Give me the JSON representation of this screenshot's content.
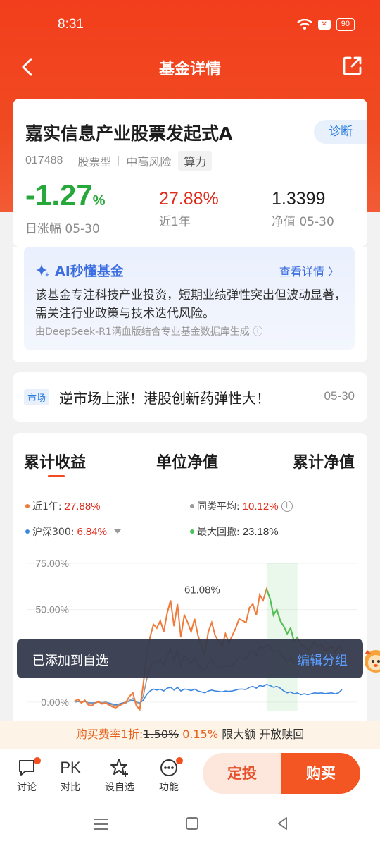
{
  "status": {
    "time": "8:31",
    "battery": "90"
  },
  "nav": {
    "title": "基金详情"
  },
  "fund": {
    "name": "嘉实信息产业股票发起式A",
    "diagnose_label": "诊断",
    "code": "017488",
    "type": "股票型",
    "risk": "中高风险",
    "tag": "算力",
    "daily_change": "-1.27",
    "daily_change_unit": "%",
    "daily_change_label": "日涨幅 05-30",
    "year_return": "27.88%",
    "year_return_label": "近1年",
    "nav_value": "1.3399",
    "nav_label": "净值 05-30"
  },
  "ai": {
    "title": "AI秒懂基金",
    "link": "查看详情 〉",
    "text": "该基金专注科技产业投资，短期业绩弹性突出但波动显著，需关注行业政策与技术迭代风险。",
    "source": "由DeepSeek-R1满血版结合专业基金数据库生成 ⓘ"
  },
  "news": {
    "tag": "市场",
    "title": "逆市场上涨！港股创新药弹性大！",
    "date": "05-30"
  },
  "chart_tabs": [
    "累计收益",
    "单位净值",
    "累计净值"
  ],
  "legend": [
    {
      "label": "近1年:",
      "value": "27.88%",
      "color": "#f07a3a",
      "value_color": "#e02b1b"
    },
    {
      "label": "同类平均:",
      "value": "10.12%",
      "color": "#999999",
      "value_color": "#e02b1b"
    },
    {
      "label": "沪深300:",
      "value": "6.84%",
      "color": "#3d86e0",
      "value_color": "#e02b1b"
    },
    {
      "label": "最大回撤:",
      "value": "23.18%",
      "color": "#4cc25a",
      "value_color": "#333333"
    }
  ],
  "chart_data": {
    "type": "line",
    "y_ticks": [
      "75.00%",
      "50.00%",
      "0.00%"
    ],
    "ylim": [
      -5,
      75
    ],
    "peak_label": "61.08%",
    "series": [
      {
        "name": "近1年",
        "color": "#f07a3a",
        "values": [
          0.5,
          1.5,
          -0.5,
          1,
          -1.5,
          -2,
          -0.5,
          0.2,
          -1,
          -0.5,
          -1.5,
          -2.5,
          -3,
          -2,
          -1,
          0,
          3,
          5,
          -2,
          -4,
          9,
          25,
          35,
          42,
          40,
          44,
          38,
          48,
          55,
          41,
          53,
          35,
          47,
          43,
          38,
          45,
          36,
          30,
          26,
          38,
          43,
          36,
          33,
          30,
          37,
          32,
          36,
          40,
          45,
          44,
          43,
          51,
          53,
          47,
          58,
          55,
          61.08,
          56,
          47,
          50,
          44,
          41,
          37,
          40,
          33,
          35,
          31,
          30,
          28,
          30,
          33,
          30,
          31,
          28,
          29,
          30,
          27,
          30,
          28
        ]
      },
      {
        "name": "同类平均",
        "color": "#9a9a9a",
        "values": [
          0,
          0.5,
          0,
          0.5,
          -0.5,
          -1,
          -0.5,
          0,
          -0.5,
          0,
          -1,
          -1.5,
          -2,
          -1.5,
          -1,
          -0.5,
          1,
          2,
          0,
          -1,
          3,
          12,
          18,
          22,
          21,
          23,
          20,
          25,
          29,
          22,
          28,
          20,
          25,
          23,
          21,
          24,
          20,
          18,
          17,
          21,
          23,
          20,
          19,
          18,
          20,
          19,
          20,
          22,
          24,
          24,
          23,
          27,
          28,
          25,
          30,
          29,
          31,
          30,
          27,
          28,
          26,
          24,
          22,
          24,
          21,
          22,
          20,
          20,
          19,
          20,
          21,
          20,
          20,
          19,
          19,
          20,
          18,
          20,
          19
        ]
      },
      {
        "name": "沪深300",
        "color": "#3d86e0",
        "values": [
          0,
          0.3,
          0,
          0.3,
          -0.3,
          -0.5,
          -0.3,
          0,
          -0.3,
          0,
          -0.5,
          -1,
          -1.5,
          -1,
          -0.5,
          0,
          0.5,
          1,
          0,
          -0.5,
          1,
          4,
          6,
          7,
          6.5,
          7,
          6,
          7.5,
          8,
          6.5,
          8,
          6,
          7,
          6.8,
          6.2,
          7,
          6,
          5.5,
          5,
          6,
          6.5,
          6,
          5.8,
          5.5,
          6,
          5.8,
          6,
          6.5,
          7,
          7,
          6.8,
          8,
          8.5,
          7.5,
          9,
          8.5,
          9.5,
          9,
          8,
          8.5,
          7.5,
          6,
          5,
          5.5,
          4.5,
          5,
          4,
          4.5,
          4,
          4.5,
          5,
          4.8,
          5,
          4.6,
          4.8,
          5,
          4.5,
          5,
          6.84
        ]
      }
    ]
  },
  "toast": {
    "text": "已添加到自选",
    "link": "编辑分组"
  },
  "fee": {
    "prefix": "购买费率1折:",
    "old": "1.50%",
    "new": "0.15%",
    "suffix": "限大额  开放赎回"
  },
  "actions": [
    {
      "label": "讨论"
    },
    {
      "label": "对比",
      "icon_text": "PK"
    },
    {
      "label": "设自选"
    },
    {
      "label": "功能"
    }
  ],
  "buttons": {
    "auto_invest": "定投",
    "buy": "购买"
  }
}
